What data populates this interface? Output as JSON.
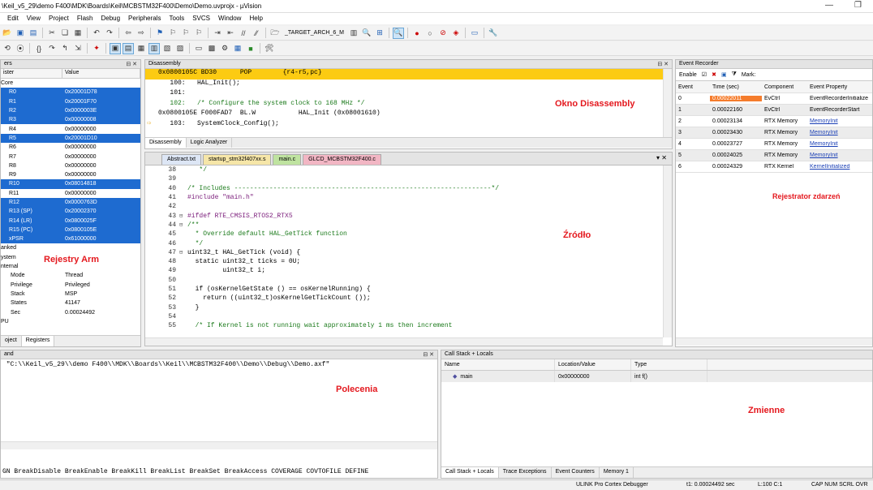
{
  "window": {
    "title": "\\Keil_v5_29\\demo F400\\MDK\\Boards\\Keil\\MCBSTM32F400\\Demo\\Demo.uvprojx - µVision"
  },
  "menu": [
    "Edit",
    "View",
    "Project",
    "Flash",
    "Debug",
    "Peripherals",
    "Tools",
    "SVCS",
    "Window",
    "Help"
  ],
  "toolbar": {
    "target": "_TARGET_ARCH_6_M"
  },
  "registers": {
    "title": "ers",
    "col_name": "ister",
    "col_value": "Value",
    "core_group": "Core",
    "rows": [
      {
        "name": "R0",
        "value": "0x20001D78",
        "sel": true
      },
      {
        "name": "R1",
        "value": "0x20001F70",
        "sel": true
      },
      {
        "name": "R2",
        "value": "0x0000003E",
        "sel": true
      },
      {
        "name": "R3",
        "value": "0x00000008",
        "sel": true
      },
      {
        "name": "R4",
        "value": "0x00000000",
        "sel": false
      },
      {
        "name": "R5",
        "value": "0x20001D10",
        "sel": true
      },
      {
        "name": "R6",
        "value": "0x00000000",
        "sel": false
      },
      {
        "name": "R7",
        "value": "0x00000000",
        "sel": false
      },
      {
        "name": "R8",
        "value": "0x00000000",
        "sel": false
      },
      {
        "name": "R9",
        "value": "0x00000000",
        "sel": false
      },
      {
        "name": "R10",
        "value": "0x08014818",
        "sel": true
      },
      {
        "name": "R11",
        "value": "0x00000000",
        "sel": false
      },
      {
        "name": "R12",
        "value": "0x0000763D",
        "sel": true
      },
      {
        "name": "R13 (SP)",
        "value": "0x20002370",
        "sel": true
      },
      {
        "name": "R14 (LR)",
        "value": "0x0800025F",
        "sel": true
      },
      {
        "name": "R15 (PC)",
        "value": "0x0800105E",
        "sel": true
      },
      {
        "name": "xPSR",
        "value": "0x61000000",
        "sel": true
      }
    ],
    "banked": "anked",
    "system": "ystem",
    "internal": "nternal",
    "internal_rows": [
      {
        "name": "Mode",
        "value": "Thread"
      },
      {
        "name": "Privilege",
        "value": "Privileged"
      },
      {
        "name": "Stack",
        "value": "MSP"
      },
      {
        "name": "States",
        "value": "41147"
      },
      {
        "name": "Sec",
        "value": "0.00024492"
      }
    ],
    "fpu": "PU",
    "tabs": [
      "oject",
      "Registers"
    ],
    "caption": "Rejestry Arm"
  },
  "disassembly": {
    "title": "Disassembly",
    "lines": [
      "0x0800105C BD30      POP        {r4-r5,pc}",
      "   100:   HAL_Init();",
      "   101:",
      "   102:   /* Configure the system clock to 168 MHz */",
      "0x0800105E F000FAD7  BL.W           HAL_Init (0x08001610)",
      "   103:   SystemClock_Config();"
    ],
    "tabs": [
      "Disassembly",
      "Logic Analyzer"
    ],
    "caption": "Okno Disassembly"
  },
  "source": {
    "tabs": [
      "Abstract.txt",
      "startup_stm32f407xx.s",
      "main.c",
      "GLCD_MCBSTM32F400.c"
    ],
    "lines": [
      {
        "n": "38",
        "code": "   */",
        "cls": "cmt"
      },
      {
        "n": "39",
        "code": "",
        "cls": ""
      },
      {
        "n": "40",
        "code": "/* Includes ------------------------------------------------------------------*/",
        "cls": "cmt"
      },
      {
        "n": "41",
        "code": "#include \"main.h\"",
        "cls": "pp"
      },
      {
        "n": "42",
        "code": "",
        "cls": ""
      },
      {
        "n": "43",
        "code": "#ifdef RTE_CMSIS_RTOS2_RTX5",
        "cls": "pp"
      },
      {
        "n": "44",
        "code": "/**",
        "cls": "cmt"
      },
      {
        "n": "45",
        "code": "  * Override default HAL_GetTick function",
        "cls": "cmt"
      },
      {
        "n": "46",
        "code": "  */",
        "cls": "cmt"
      },
      {
        "n": "47",
        "code": "uint32_t HAL_GetTick (void) {",
        "cls": ""
      },
      {
        "n": "48",
        "code": "  static uint32_t ticks = 0U;",
        "cls": ""
      },
      {
        "n": "49",
        "code": "         uint32_t i;",
        "cls": ""
      },
      {
        "n": "50",
        "code": "",
        "cls": ""
      },
      {
        "n": "51",
        "code": "  if (osKernelGetState () == osKernelRunning) {",
        "cls": ""
      },
      {
        "n": "52",
        "code": "    return ((uint32_t)osKernelGetTickCount ());",
        "cls": ""
      },
      {
        "n": "53",
        "code": "  }",
        "cls": ""
      },
      {
        "n": "54",
        "code": "",
        "cls": ""
      },
      {
        "n": "55",
        "code": "  /* If Kernel is not running wait approximately 1 ms then increment",
        "cls": "cmt"
      }
    ],
    "caption": "Źródło"
  },
  "events": {
    "title": "Event Recorder",
    "enable": "Enable",
    "mark": "Mark:",
    "headers": [
      "Event",
      "Time (sec)",
      "Component",
      "Event Property"
    ],
    "rows": [
      {
        "e": "0",
        "t": "0.00022011",
        "c": "EvCtrl",
        "p": "EventRecorderInitialize",
        "link": false
      },
      {
        "e": "1",
        "t": "0.00022160",
        "c": "EvCtrl",
        "p": "EventRecorderStart",
        "link": false
      },
      {
        "e": "2",
        "t": "0.00023134",
        "c": "RTX Memory",
        "p": "MemoryInit",
        "link": true
      },
      {
        "e": "3",
        "t": "0.00023430",
        "c": "RTX Memory",
        "p": "MemoryInit",
        "link": true
      },
      {
        "e": "4",
        "t": "0.00023727",
        "c": "RTX Memory",
        "p": "MemoryInit",
        "link": true
      },
      {
        "e": "5",
        "t": "0.00024025",
        "c": "RTX Memory",
        "p": "MemoryInit",
        "link": true
      },
      {
        "e": "6",
        "t": "0.00024329",
        "c": "RTX Kernel",
        "p": "KernelInitialized",
        "link": true
      }
    ],
    "caption": "Rejestrator zdarzeń"
  },
  "command": {
    "title": "and",
    "line": " \"C:\\\\Keil_v5_29\\\\demo F400\\\\MDK\\\\Boards\\\\Keil\\\\MCBSTM32F400\\\\Demo\\\\Debug\\\\Demo.axf\"",
    "hint": "GN BreakDisable BreakEnable BreakKill BreakList BreakSet BreakAccess COVERAGE COVTOFILE DEFINE",
    "caption": "Polecenia"
  },
  "callstack": {
    "title": "Call Stack + Locals",
    "headers": [
      "Name",
      "Location/Value",
      "Type"
    ],
    "row": {
      "name": "main",
      "value": "0x00000000",
      "type": "int f()"
    },
    "tabs": [
      "Call Stack + Locals",
      "Trace Exceptions",
      "Event Counters",
      "Memory 1"
    ],
    "caption": "Zmienne"
  },
  "status": {
    "debugger": "ULINK Pro Cortex Debugger",
    "time": "t1: 0.00024492 sec",
    "line": "L:100 C:1",
    "flags": "CAP  NUM  SCRL  OVR"
  }
}
